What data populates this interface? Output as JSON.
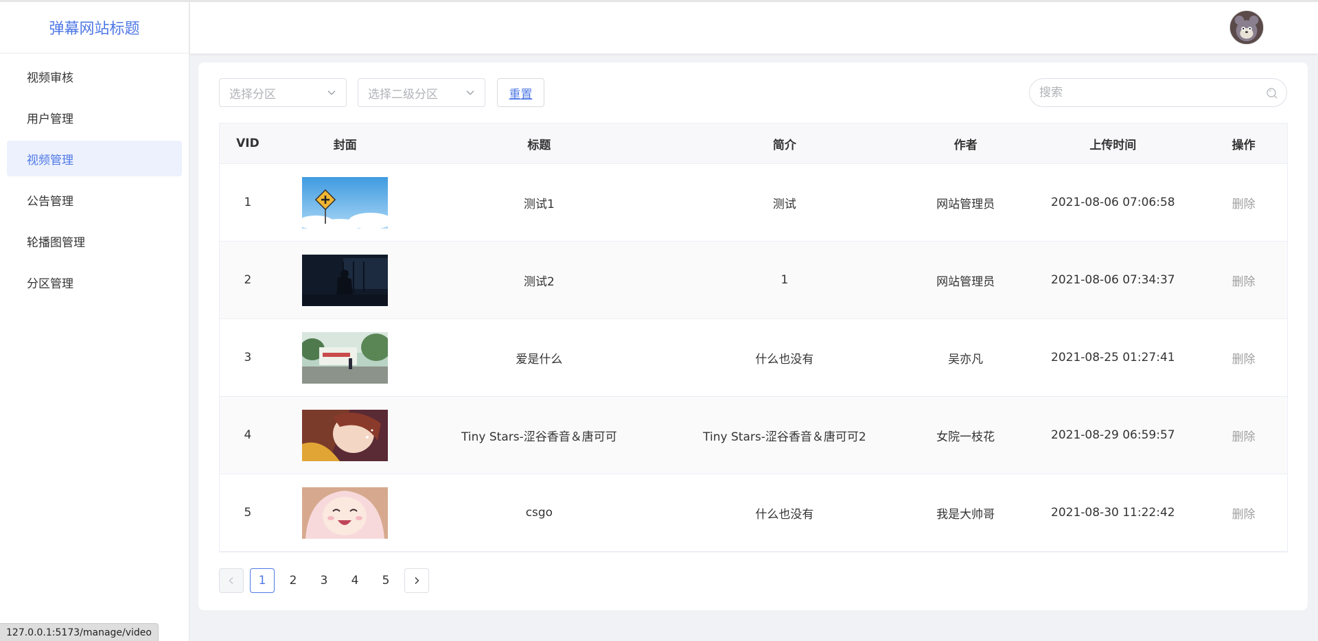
{
  "app": {
    "title": "弹幕网站标题"
  },
  "sidebar": {
    "items": [
      {
        "label": "视频审核",
        "active": false
      },
      {
        "label": "用户管理",
        "active": false
      },
      {
        "label": "视频管理",
        "active": true
      },
      {
        "label": "公告管理",
        "active": false
      },
      {
        "label": "轮播图管理",
        "active": false
      },
      {
        "label": "分区管理",
        "active": false
      }
    ]
  },
  "toolbar": {
    "select_category_placeholder": "选择分区",
    "select_subcategory_placeholder": "选择二级分区",
    "reset_label": "重置",
    "search_placeholder": "搜索"
  },
  "table": {
    "headers": [
      "VID",
      "封面",
      "标题",
      "简介",
      "作者",
      "上传时间",
      "操作"
    ],
    "rows": [
      {
        "vid": "1",
        "title": "测试1",
        "desc": "测试",
        "author": "网站管理员",
        "time": "2021-08-06 07:06:58",
        "op": "删除",
        "cover": "sky-sign"
      },
      {
        "vid": "2",
        "title": "测试2",
        "desc": "1",
        "author": "网站管理员",
        "time": "2021-08-06 07:34:37",
        "op": "删除",
        "cover": "dark-room"
      },
      {
        "vid": "3",
        "title": "爱是什么",
        "desc": "什么也没有",
        "author": "吴亦凡",
        "time": "2021-08-25 01:27:41",
        "op": "删除",
        "cover": "street-scene"
      },
      {
        "vid": "4",
        "title": "Tiny Stars-涩谷香音＆唐可可",
        "desc": "Tiny Stars-涩谷香音＆唐可可2",
        "author": "女院一枝花",
        "time": "2021-08-29 06:59:57",
        "op": "删除",
        "cover": "anime-hug"
      },
      {
        "vid": "5",
        "title": "csgo",
        "desc": "什么也没有",
        "author": "我是大帅哥",
        "time": "2021-08-30 11:22:42",
        "op": "删除",
        "cover": "anime-girl"
      }
    ]
  },
  "pagination": {
    "pages": [
      "1",
      "2",
      "3",
      "4",
      "5"
    ],
    "current": "1"
  },
  "status_bar": {
    "url": "127.0.0.1:5173/manage/video"
  },
  "colors": {
    "accent": "#4f78e6",
    "active_bg": "#ecf1fd",
    "page_bg": "#f0f2f5"
  }
}
